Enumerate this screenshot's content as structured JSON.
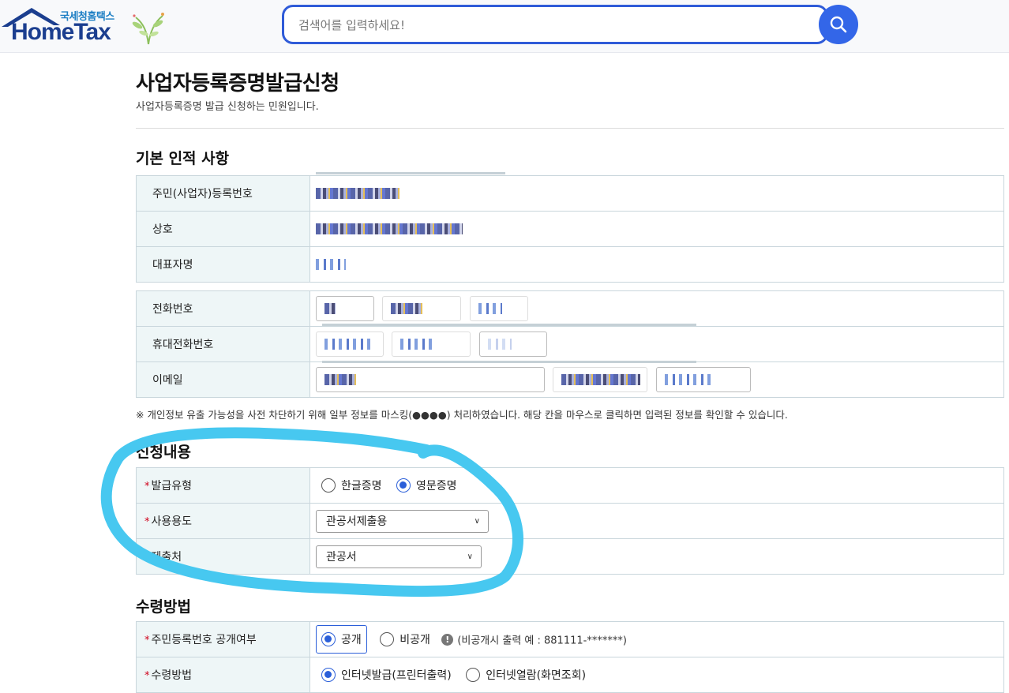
{
  "header": {
    "logo_small": "국세청홈택스",
    "logo_big": "HomeTax",
    "search_placeholder": "검색어를 입력하세요!"
  },
  "page": {
    "title": "사업자등록증명발급신청",
    "subtitle": "사업자등록증명 발급 신청하는 민원입니다."
  },
  "basic": {
    "section_title": "기본 인적 사항",
    "rows": [
      {
        "label": "주민(사업자)등록번호"
      },
      {
        "label": "상호"
      },
      {
        "label": "대표자명"
      }
    ]
  },
  "contact": {
    "rows": [
      {
        "label": "전화번호"
      },
      {
        "label": "휴대전화번호"
      },
      {
        "label": "이메일"
      }
    ],
    "note": "※ 개인정보 유출 가능성을 사전 차단하기 위해 일부 정보를 마스킹(●●●●) 처리하였습니다. 해당 칸을 마우스로 클릭하면 입력된 정보를 확인할 수 있습니다."
  },
  "application": {
    "section_title": "신청내용",
    "required_mark": "*",
    "issue_type_label": "발급유형",
    "issue_type_options": [
      "한글증명",
      "영문증명"
    ],
    "issue_type_selected": "영문증명",
    "usage_label": "사용용도",
    "usage_value": "관공서제출용",
    "submit_to_label": "제출처",
    "submit_to_value": "관공서"
  },
  "receipt": {
    "section_title": "수령방법",
    "disclosure_label": "주민등록번호 공개여부",
    "disclosure_options": [
      "공개",
      "비공개"
    ],
    "disclosure_selected": "공개",
    "disclosure_hint": "(비공개시 출력 예 : 881111-*******)",
    "method_label": "수령방법",
    "method_options": [
      "인터넷발급(프린터출력)",
      "인터넷열람(화면조회)"
    ],
    "method_selected": "인터넷발급(프린터출력)"
  },
  "colors": {
    "accent": "#2b5fd9",
    "annotation": "#47c8f0",
    "header_bg": "#eef6f7"
  }
}
